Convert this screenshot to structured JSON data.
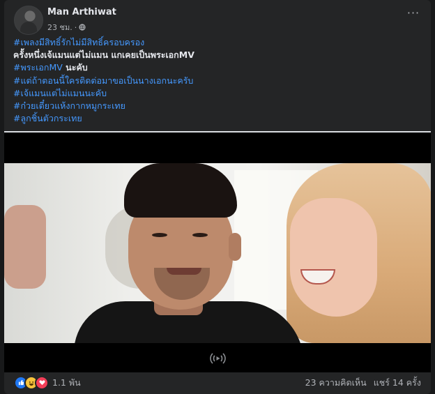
{
  "post": {
    "author": "Man Arthiwat",
    "time": "23 ชม.",
    "separator": "·",
    "more_label": "···",
    "lines": [
      {
        "type": "tag",
        "text": "#เพลงมีสิทธิ์รักไม่มีสิทธิ์ครอบครอง"
      },
      {
        "type": "text",
        "text": "ครั้งหนึ่งเจ้แมนแต่ไม่แมน แกเคยเป็นพระเอกMV"
      },
      {
        "type": "mixed",
        "tag": "#พระเอกMV",
        "text": " นะคับ"
      },
      {
        "type": "tag",
        "text": "#แต่ถ้าตอนนี้ใครติดต่อมาขอเป็นนางเอกนะครับ"
      },
      {
        "type": "tag",
        "text": "#เจ้แมนแต่ไม่แมนนะคับ"
      },
      {
        "type": "tag",
        "text": "#ก๋วยเตี๋ยวแห้งกากหมูกระเทย"
      },
      {
        "type": "tag",
        "text": "#ลูกชิ้นตัวกระเทย"
      }
    ]
  },
  "video": {
    "sound_icon": "sound-wave-icon"
  },
  "footer": {
    "reaction_count": "1.1 พัน",
    "comments": "23 ความคิดเห็น",
    "shares": "แชร์ 14 ครั้ง"
  },
  "colors": {
    "background": "#18191a",
    "card": "#242526",
    "hashtag": "#4599ff",
    "text": "#e4e6eb",
    "secondary_text": "#b0b3b8"
  }
}
